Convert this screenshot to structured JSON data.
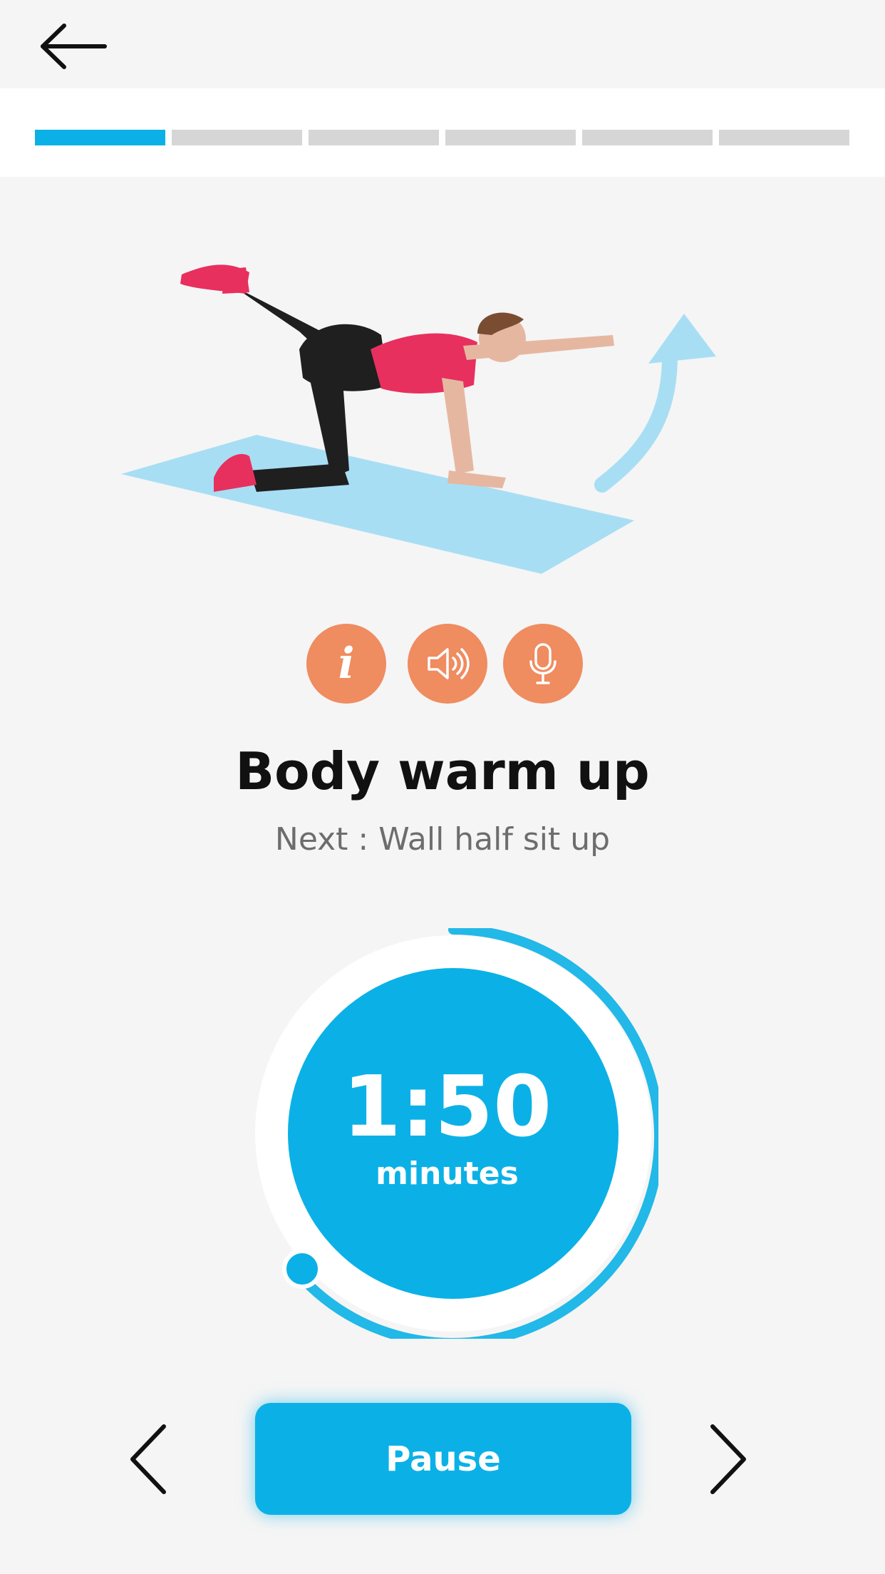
{
  "header": {
    "back_icon": "arrow-left-icon"
  },
  "progress": {
    "segments": 6,
    "current": 1,
    "active_color": "#0bb1e6",
    "inactive_color": "#d6d6d6"
  },
  "exercise": {
    "title": "Body warm up",
    "next_label": "Next : Wall half sit up",
    "illustration": "woman-bird-dog-exercise-illustration"
  },
  "action_buttons": [
    {
      "name": "info-button",
      "icon": "info-icon",
      "glyph": "i"
    },
    {
      "name": "sound-button",
      "icon": "speaker-icon"
    },
    {
      "name": "voice-button",
      "icon": "microphone-icon"
    }
  ],
  "timer": {
    "time": "1:50",
    "unit": "minutes",
    "color": "#0bb1e6"
  },
  "controls": {
    "pause_label": "Pause",
    "prev_icon": "chevron-left-icon",
    "next_icon": "chevron-right-icon"
  },
  "colors": {
    "accent": "#0bb1e6",
    "action": "#ef8c60",
    "background": "#f5f5f5"
  }
}
